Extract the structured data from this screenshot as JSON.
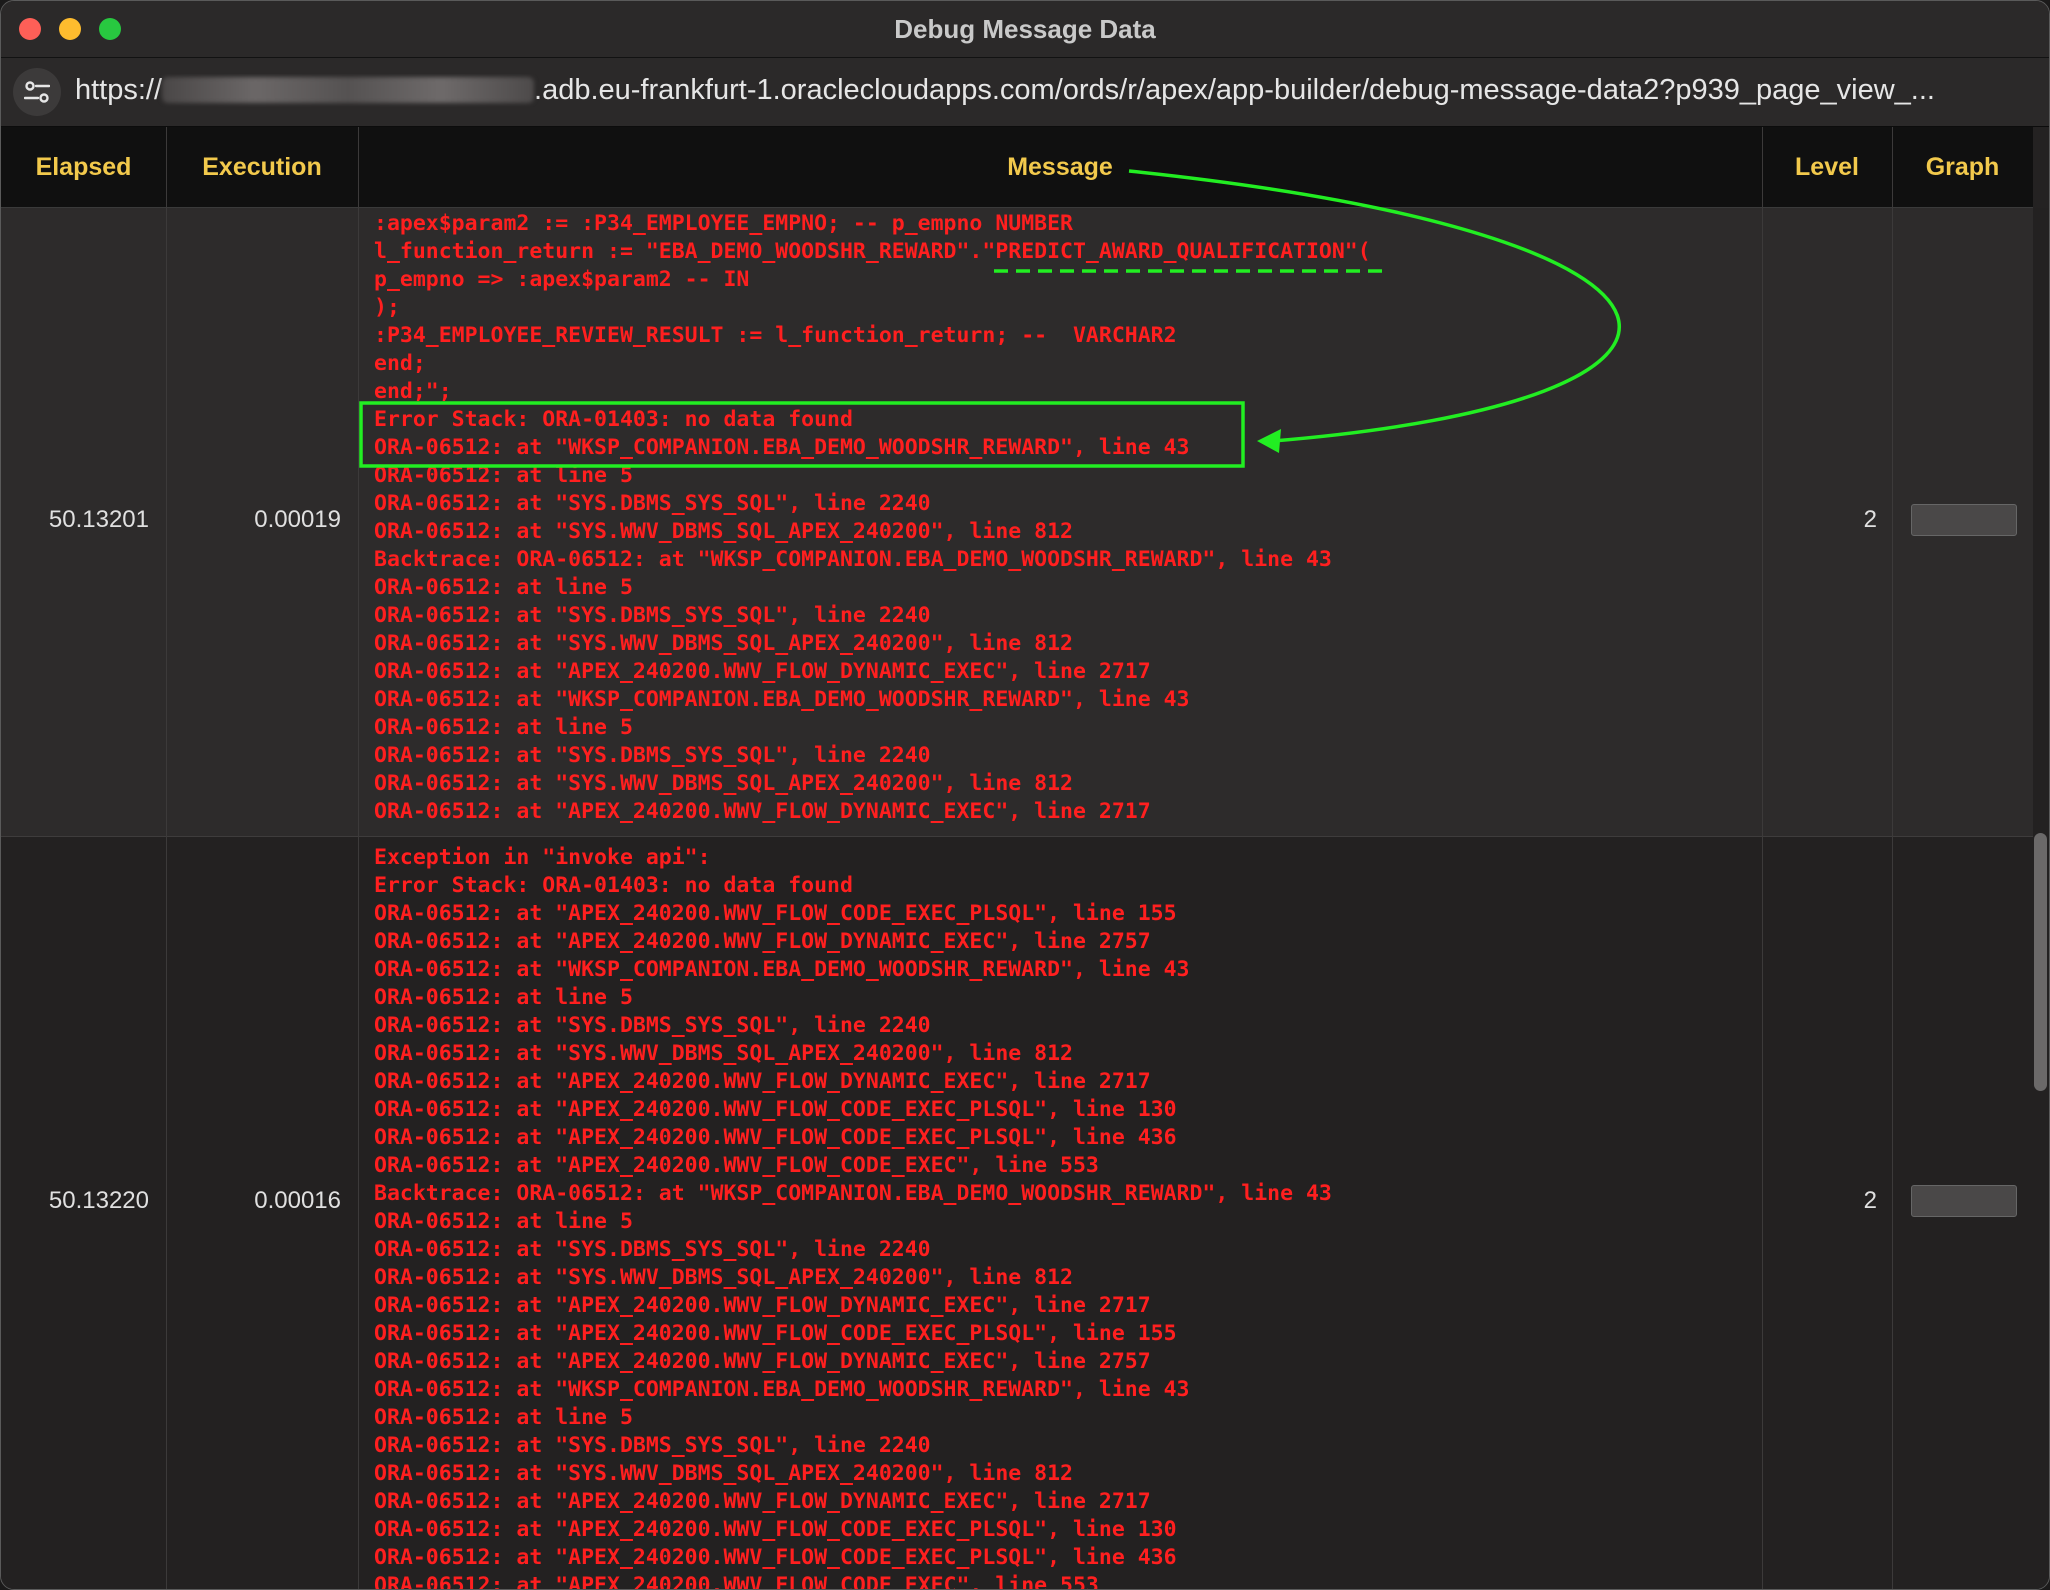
{
  "window": {
    "title": "Debug Message Data"
  },
  "address_bar": {
    "prefix": "https://",
    "suffix": ".adb.eu-frankfurt-1.oraclecloudapps.com/ords/r/apex/app-builder/debug-message-data2?p939_page_view_..."
  },
  "table": {
    "headers": {
      "elapsed": "Elapsed",
      "execution": "Execution",
      "message": "Message",
      "level": "Level",
      "graph": "Graph"
    },
    "rows": [
      {
        "elapsed": "50.13201",
        "execution": "0.00019",
        "level": "2",
        "message": ":apex$param2 := :P34_EMPLOYEE_EMPNO; -- p_empno NUMBER\nl_function_return := \"EBA_DEMO_WOODSHR_REWARD\".\"PREDICT_AWARD_QUALIFICATION\"(\np_empno => :apex$param2 -- IN\n);\n:P34_EMPLOYEE_REVIEW_RESULT := l_function_return; --  VARCHAR2\nend;\nend;\";\nError Stack: ORA-01403: no data found\nORA-06512: at \"WKSP_COMPANION.EBA_DEMO_WOODSHR_REWARD\", line 43\nORA-06512: at line 5\nORA-06512: at \"SYS.DBMS_SYS_SQL\", line 2240\nORA-06512: at \"SYS.WWV_DBMS_SQL_APEX_240200\", line 812\nBacktrace: ORA-06512: at \"WKSP_COMPANION.EBA_DEMO_WOODSHR_REWARD\", line 43\nORA-06512: at line 5\nORA-06512: at \"SYS.DBMS_SYS_SQL\", line 2240\nORA-06512: at \"SYS.WWV_DBMS_SQL_APEX_240200\", line 812\nORA-06512: at \"APEX_240200.WWV_FLOW_DYNAMIC_EXEC\", line 2717\nORA-06512: at \"WKSP_COMPANION.EBA_DEMO_WOODSHR_REWARD\", line 43\nORA-06512: at line 5\nORA-06512: at \"SYS.DBMS_SYS_SQL\", line 2240\nORA-06512: at \"SYS.WWV_DBMS_SQL_APEX_240200\", line 812\nORA-06512: at \"APEX_240200.WWV_FLOW_DYNAMIC_EXEC\", line 2717"
      },
      {
        "elapsed": "50.13220",
        "execution": "0.00016",
        "level": "2",
        "message": "Exception in \"invoke api\":\nError Stack: ORA-01403: no data found\nORA-06512: at \"APEX_240200.WWV_FLOW_CODE_EXEC_PLSQL\", line 155\nORA-06512: at \"APEX_240200.WWV_FLOW_DYNAMIC_EXEC\", line 2757\nORA-06512: at \"WKSP_COMPANION.EBA_DEMO_WOODSHR_REWARD\", line 43\nORA-06512: at line 5\nORA-06512: at \"SYS.DBMS_SYS_SQL\", line 2240\nORA-06512: at \"SYS.WWV_DBMS_SQL_APEX_240200\", line 812\nORA-06512: at \"APEX_240200.WWV_FLOW_DYNAMIC_EXEC\", line 2717\nORA-06512: at \"APEX_240200.WWV_FLOW_CODE_EXEC_PLSQL\", line 130\nORA-06512: at \"APEX_240200.WWV_FLOW_CODE_EXEC_PLSQL\", line 436\nORA-06512: at \"APEX_240200.WWV_FLOW_CODE_EXEC\", line 553\nBacktrace: ORA-06512: at \"WKSP_COMPANION.EBA_DEMO_WOODSHR_REWARD\", line 43\nORA-06512: at line 5\nORA-06512: at \"SYS.DBMS_SYS_SQL\", line 2240\nORA-06512: at \"SYS.WWV_DBMS_SQL_APEX_240200\", line 812\nORA-06512: at \"APEX_240200.WWV_FLOW_DYNAMIC_EXEC\", line 2717\nORA-06512: at \"APEX_240200.WWV_FLOW_CODE_EXEC_PLSQL\", line 155\nORA-06512: at \"APEX_240200.WWV_FLOW_DYNAMIC_EXEC\", line 2757\nORA-06512: at \"WKSP_COMPANION.EBA_DEMO_WOODSHR_REWARD\", line 43\nORA-06512: at line 5\nORA-06512: at \"SYS.DBMS_SYS_SQL\", line 2240\nORA-06512: at \"SYS.WWV_DBMS_SQL_APEX_240200\", line 812\nORA-06512: at \"APEX_240200.WWV_FLOW_DYNAMIC_EXEC\", line 2717\nORA-06512: at \"APEX_240200.WWV_FLOW_CODE_EXEC_PLSQL\", line 130\nORA-06512: at \"APEX_240200.WWV_FLOW_CODE_EXEC_PLSQL\", line 436\nORA-06512: at \"APEX_240200.WWV_FLOW_CODE_EXEC\", line 553"
      }
    ]
  },
  "colors": {
    "header_text": "#f2c94c",
    "message_text": "#ff1f1f",
    "annotation_green": "#22ee22"
  },
  "icons": {
    "site_settings": "sliders-icon"
  }
}
